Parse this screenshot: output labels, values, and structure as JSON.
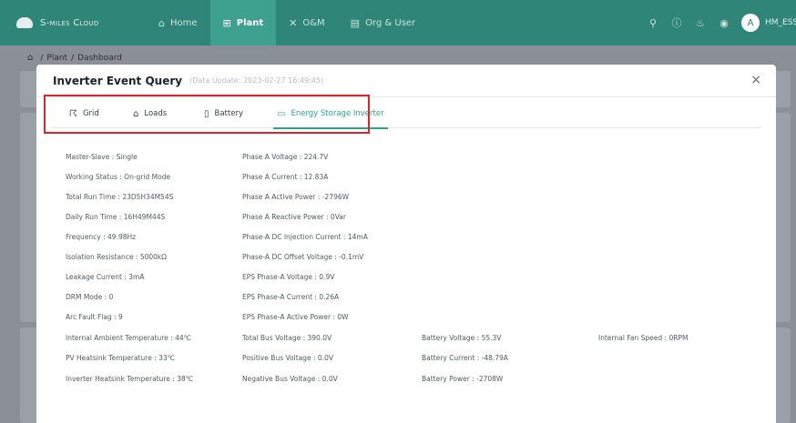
{
  "topbar": {
    "brand": "S-miles Cloud",
    "nav": [
      {
        "label": "Home",
        "icon": "⌂",
        "active": false
      },
      {
        "label": "Plant",
        "icon": "⊞",
        "active": true
      },
      {
        "label": "O&M",
        "icon": "✕",
        "active": false
      },
      {
        "label": "Org & User",
        "icon": "▤",
        "active": false
      }
    ],
    "avatar_letter": "A",
    "username": "HM_ESS_"
  },
  "breadcrumb": {
    "items": [
      "Plant",
      "Dashboard"
    ],
    "separator": "/"
  },
  "modal": {
    "title": "Inverter Event Query",
    "subtitle": "(Data Update: 2023-02-27 16:49:45)",
    "close": "×",
    "tabs": [
      {
        "label": "Grid",
        "icon": "☈"
      },
      {
        "label": "Loads",
        "icon": "⌂"
      },
      {
        "label": "Battery",
        "icon": "▯"
      },
      {
        "label": "Energy Storage Inverter",
        "icon": "▭"
      }
    ],
    "active_tab": "Energy Storage Inverter",
    "col1": [
      "Master-Slave : Single",
      "Working Status : On-grid Mode",
      "Total Run Time : 23D5H34M54S",
      "Daily Run Time : 16H49M44S",
      "Frequency : 49.98Hz",
      "Isolation Resistance : 5000kΩ",
      "Leakage Current : 3mA",
      "DRM Mode : 0",
      "Arc Fault Flag : 9",
      "Internal Ambient Temperature : 44℃",
      "PV Heatsink Temperature : 33℃",
      "Inverter Heatsink Temperature : 38℃"
    ],
    "col2": [
      "Phase A Voltage : 224.7V",
      "Phase A Current : 12.83A",
      "Phase A Active Power : -2796W",
      "Phase A Reactive Power : 0Var",
      "Phase-A DC Injection Current : 14mA",
      "Phase-A DC Offset Voltage : -0.1mV",
      "EPS Phase-A Voltage : 0.9V",
      "EPS Phase-A Current : 0.26A",
      "EPS Phase-A Active Power : 0W",
      "Total Bus Voltage : 390.0V",
      "Positive Bus Voltage : 0.0V",
      "Negative Bus Voltage : 0.0V"
    ],
    "col3": [
      "Battery Voltage : 55.3V",
      "Battery Current : -48.79A",
      "Battery Power : -2708W"
    ],
    "col4": [
      "Internal Fan Speed : 0RPM"
    ]
  },
  "colors": {
    "topbar": "#2f8577",
    "nav_active": "#3ea08e",
    "accent": "#2aa58a",
    "highlight": "#e0232b"
  },
  "icons": [
    "cloud-logo-icon",
    "search-icon",
    "help-icon",
    "bell-icon",
    "globe-icon",
    "home-icon",
    "close-icon"
  ]
}
